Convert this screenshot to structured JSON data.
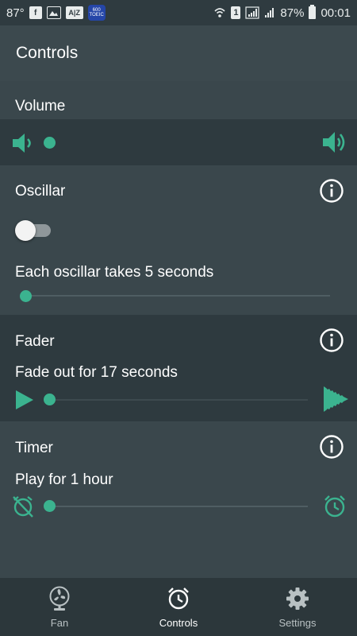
{
  "status_bar": {
    "temperature": "87°",
    "az_label": "A|Z",
    "dict_label": "600 TOEIC",
    "sim_number": "1",
    "battery_percent": "87%",
    "time": "00:01"
  },
  "app_bar": {
    "title": "Controls"
  },
  "volume": {
    "label": "Volume",
    "level": 0
  },
  "oscillar": {
    "label": "Oscillar",
    "toggle_on": false,
    "speed_text": "Each oscillar takes 5 seconds",
    "speed_level": 0
  },
  "fader": {
    "label": "Fader",
    "description": "Fade out for 17 seconds",
    "level": 0
  },
  "timer": {
    "label": "Timer",
    "description": "Play for 1 hour",
    "level": 0
  },
  "bottom_nav": {
    "items": [
      {
        "label": "Fan",
        "icon": "fan-icon",
        "active": false
      },
      {
        "label": "Controls",
        "icon": "alarm-clock-icon",
        "active": true
      },
      {
        "label": "Settings",
        "icon": "gear-icon",
        "active": false
      }
    ]
  },
  "colors": {
    "accent": "#3bb38f",
    "background_dark": "#2e3a3f",
    "background_light": "#3a474c",
    "nav_background": "#2c373b"
  }
}
